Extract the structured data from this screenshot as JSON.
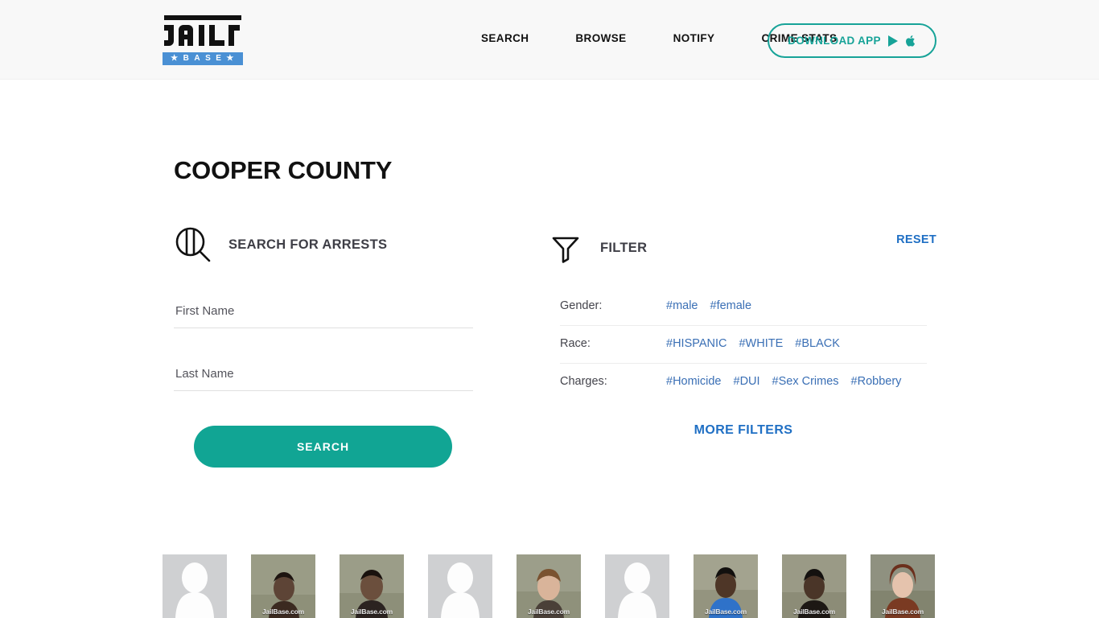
{
  "header": {
    "logo": {
      "word": "JAIL",
      "base_letters": [
        "B",
        "A",
        "S",
        "E"
      ],
      "star": "★"
    },
    "nav": [
      {
        "label": "SEARCH",
        "name": "nav-search"
      },
      {
        "label": "BROWSE",
        "name": "nav-browse"
      },
      {
        "label": "NOTIFY",
        "name": "nav-notify"
      },
      {
        "label": "CRIME STATS",
        "name": "nav-crime-stats"
      }
    ],
    "download_button": {
      "label": "DOWNLOAD APP",
      "icons": [
        "google-play-icon",
        "apple-icon"
      ]
    }
  },
  "page": {
    "title": "COOPER COUNTY"
  },
  "search_panel": {
    "icon": "jail-magnifier-icon",
    "heading": "SEARCH FOR ARRESTS",
    "first_name": {
      "value": "",
      "placeholder": "First Name"
    },
    "last_name": {
      "value": "",
      "placeholder": "Last Name"
    },
    "search_button": "SEARCH"
  },
  "filter_panel": {
    "icon": "funnel-icon",
    "heading": "FILTER",
    "reset": "RESET",
    "rows": [
      {
        "label": "Gender:",
        "tags": [
          "#male",
          "#female"
        ]
      },
      {
        "label": "Race:",
        "tags": [
          "#HISPANIC",
          "#WHITE",
          "#BLACK"
        ]
      },
      {
        "label": "Charges:",
        "tags": [
          "#Homicide",
          "#DUI",
          "#Sex Crimes",
          "#Robbery"
        ]
      }
    ],
    "more_filters": "MORE FILTERS"
  },
  "thumbnails": [
    {
      "type": "placeholder",
      "watermark": ""
    },
    {
      "type": "photo",
      "watermark": "JailBase.com"
    },
    {
      "type": "photo",
      "watermark": "JailBase.com"
    },
    {
      "type": "placeholder",
      "watermark": ""
    },
    {
      "type": "photo",
      "watermark": "JailBase.com"
    },
    {
      "type": "placeholder",
      "watermark": ""
    },
    {
      "type": "photo",
      "watermark": "JailBase.com"
    },
    {
      "type": "photo",
      "watermark": "JailBase.com"
    },
    {
      "type": "photo",
      "watermark": "JailBase.com"
    }
  ],
  "colors": {
    "teal": "#17a398",
    "teal_button": "#11a594",
    "link_blue": "#3a6fb5",
    "action_blue": "#1f6fc4",
    "logo_blue": "#4a90d4",
    "header_bg": "#f8f8f8"
  }
}
